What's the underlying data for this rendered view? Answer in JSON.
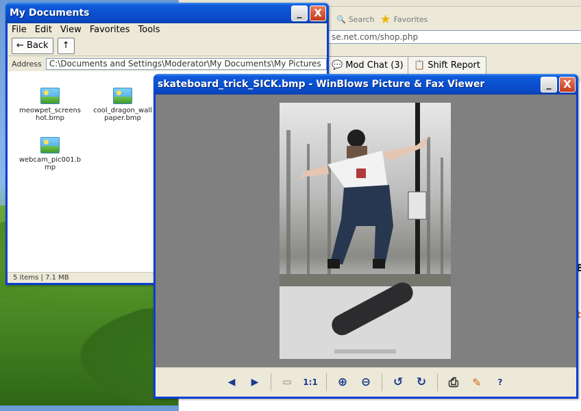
{
  "browser": {
    "toolbar_search": "Search",
    "toolbar_favorites": "Favorites",
    "address": "se.net.com/shop.php",
    "mod_chat_label": "Mod Chat (3)",
    "shift_report_label": "Shift Report",
    "side_snippet_1": "E",
    "side_snippet_2": "t"
  },
  "mydocs": {
    "title": "My Documents",
    "min_label": "_",
    "close_label": "X",
    "menu": [
      "File",
      "Edit",
      "View",
      "Favorites",
      "Tools"
    ],
    "back_label": "← Back",
    "up_label": "↑",
    "address_label": "Address",
    "address": "C:\\Documents and Settings\\Moderator\\My Documents\\My Pictures",
    "files": [
      {
        "name": "meowpet_screenshot.bmp"
      },
      {
        "name": "cool_dragon_wallpaper.bmp"
      },
      {
        "name": "webcam_pic001.bmp"
      }
    ],
    "status": "5 items | 7.1 MB"
  },
  "viewer": {
    "title": "skateboard_trick_SICK.bmp - WinBlows Picture & Fax Viewer",
    "min_label": "_",
    "close_label": "X",
    "toolbar": {
      "prev": "◀",
      "next": "▶",
      "best_fit": "▭",
      "actual_size": "1:1",
      "zoom_in": "⊕",
      "zoom_out": "⊖",
      "rotate_left": "↺",
      "rotate_right": "↻",
      "print": "⎙",
      "edit": "✎",
      "help": "?"
    }
  },
  "colors": {
    "title_blue": "#0a4fd0",
    "close_red": "#c4391a",
    "window_bg": "#ece9d8"
  }
}
